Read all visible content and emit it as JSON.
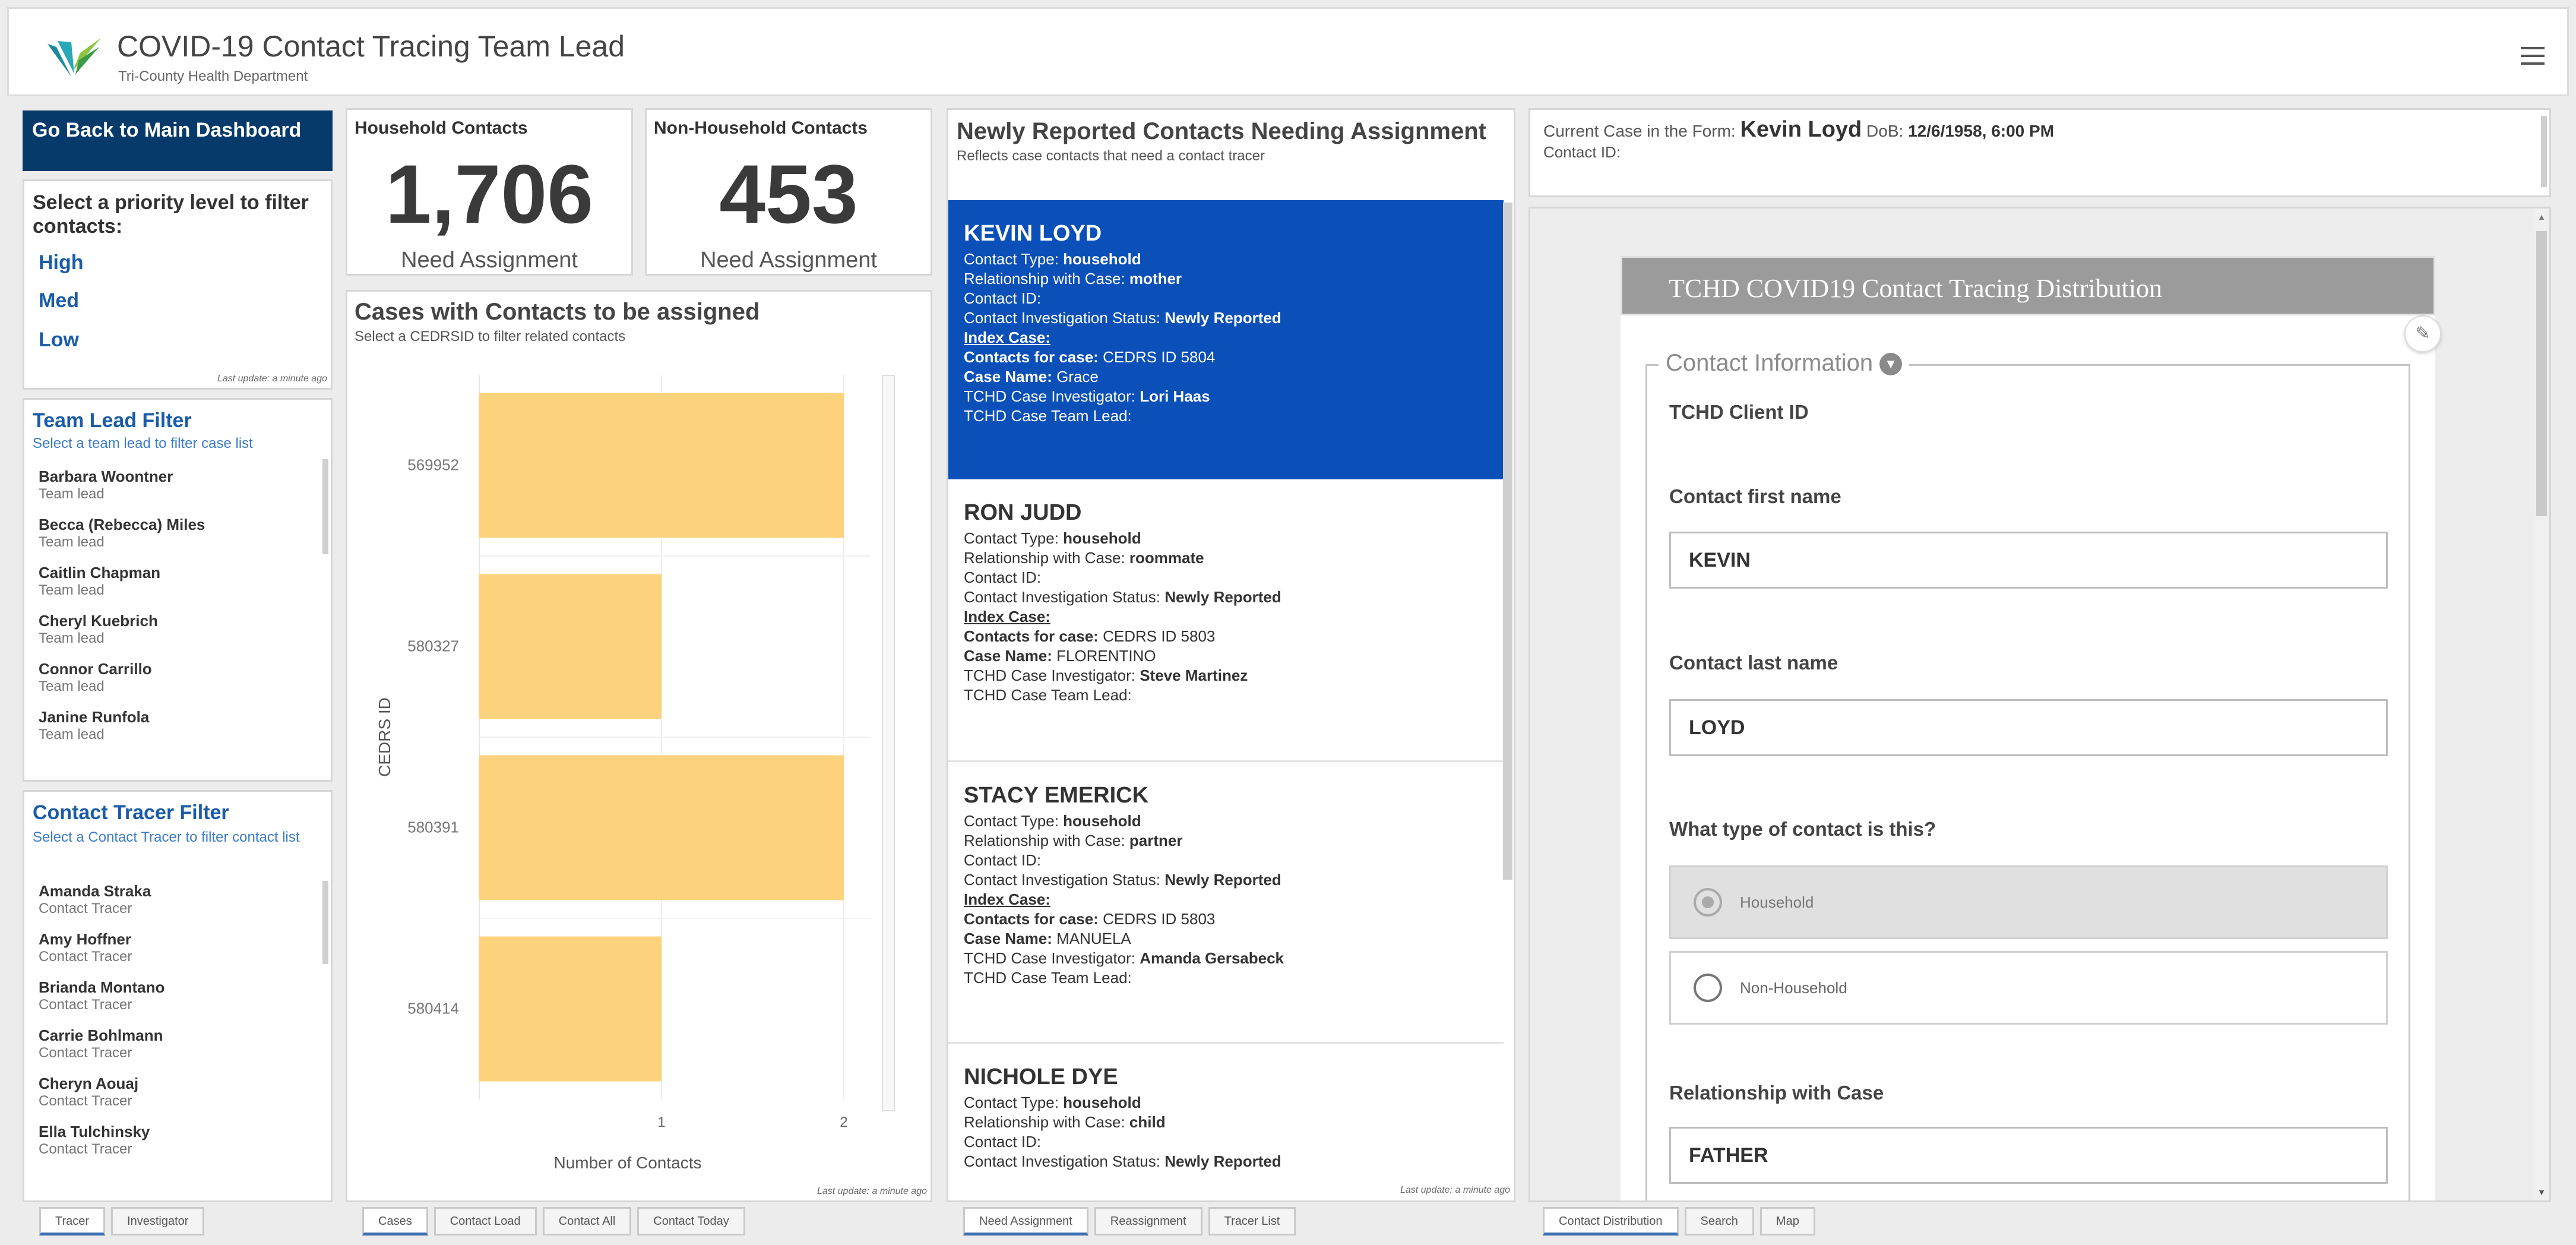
{
  "header": {
    "title": "COVID-19 Contact Tracing Team Lead",
    "subtitle": "Tri-County Health Department",
    "menu_icon": "hamburger-icon"
  },
  "left": {
    "back_button": "Go Back to Main Dashboard",
    "priority": {
      "title": "Select a priority level to filter contacts:",
      "items": [
        "High",
        "Med",
        "Low"
      ],
      "last_update": "Last update: a minute ago"
    },
    "team_lead": {
      "title": "Team Lead Filter",
      "subtitle": "Select a team lead to filter case list",
      "items": [
        {
          "name": "Barbara Woontner",
          "role": "Team lead"
        },
        {
          "name": "Becca (Rebecca) Miles",
          "role": "Team lead"
        },
        {
          "name": "Caitlin Chapman",
          "role": "Team lead"
        },
        {
          "name": "Cheryl Kuebrich",
          "role": "Team lead"
        },
        {
          "name": "Connor Carrillo",
          "role": "Team lead"
        },
        {
          "name": "Janine Runfola",
          "role": "Team lead"
        }
      ]
    },
    "tracer": {
      "title": "Contact Tracer Filter",
      "subtitle": "Select a Contact Tracer to filter contact list",
      "items": [
        {
          "name": "Amanda Straka",
          "role": "Contact Tracer"
        },
        {
          "name": "Amy Hoffner",
          "role": "Contact Tracer"
        },
        {
          "name": "Brianda Montano",
          "role": "Contact Tracer"
        },
        {
          "name": "Carrie Bohlmann",
          "role": "Contact Tracer"
        },
        {
          "name": "Cheryn Aouaj",
          "role": "Contact Tracer"
        },
        {
          "name": "Ella Tulchinsky",
          "role": "Contact Tracer"
        }
      ]
    },
    "tabs": [
      "Tracer",
      "Investigator"
    ]
  },
  "indicators": {
    "household": {
      "title": "Household Contacts",
      "value": "1,706",
      "label": "Need Assignment"
    },
    "non_household": {
      "title": "Non-Household Contacts",
      "value": "453",
      "label": "Need Assignment"
    }
  },
  "chart_panel": {
    "title": "Cases with Contacts to be assigned",
    "subtitle": "Select a CEDRSID to filter related contacts",
    "last_update": "Last update: a minute ago",
    "tabs": [
      "Cases",
      "Contact Load",
      "Contact All",
      "Contact Today"
    ]
  },
  "chart_data": {
    "type": "bar",
    "orientation": "horizontal",
    "categories": [
      "569952",
      "580327",
      "580391",
      "580414"
    ],
    "values": [
      2,
      1,
      2,
      1
    ],
    "xlabel": "Number of Contacts",
    "ylabel": "CEDRS ID",
    "xticks": [
      "1",
      "2"
    ],
    "xlim": [
      0,
      2.15
    ],
    "bar_color": "#fdd27c"
  },
  "contacts_panel": {
    "title": "Newly Reported Contacts Needing Assignment",
    "subtitle": "Reflects case contacts that need a contact tracer",
    "last_update": "Last update: a minute ago",
    "tabs": [
      "Need Assignment",
      "Reassignment",
      "Tracer List"
    ],
    "labels": {
      "type": "Contact Type: ",
      "rel": "Relationship with Case: ",
      "id": "Contact ID:",
      "status": "Contact Investigation Status: ",
      "index": "Index Case:",
      "for_case": "Contacts for case: ",
      "case_name": "Case Name: ",
      "investigator": "TCHD Case Investigator: ",
      "team_lead": "TCHD Case Team Lead:"
    },
    "contacts": [
      {
        "name": "KEVIN  LOYD",
        "type": "household",
        "rel": "mother",
        "status": "Newly Reported",
        "for_case": "CEDRS ID 5804",
        "case_name": "Grace",
        "investigator": "Lori Haas"
      },
      {
        "name": "RON JUDD",
        "type": "household",
        "rel": "roommate",
        "status": "Newly Reported",
        "for_case": "CEDRS ID 5803",
        "case_name": "FLORENTINO",
        "investigator": "Steve Martinez"
      },
      {
        "name": "STACY EMERICK",
        "type": "household",
        "rel": "partner",
        "status": "Newly Reported",
        "for_case": "CEDRS ID 5803",
        "case_name": "MANUELA",
        "investigator": "Amanda Gersabeck"
      },
      {
        "name": "NICHOLE DYE",
        "type": "household",
        "rel": "child",
        "status": "Newly Reported"
      }
    ]
  },
  "form_panel": {
    "current_label": "Current Case in the Form: ",
    "current_name": "Kevin Loyd",
    "dob_label": " DoB: ",
    "dob": "12/6/1958, 6:00 PM",
    "contact_id": "Contact ID:",
    "tabs": [
      "Contact Distribution",
      "Search",
      "Map"
    ],
    "form": {
      "banner": "TCHD COVID19 Contact Tracing Distribution",
      "section": "Contact Information",
      "client_id_label": "TCHD Client ID",
      "first_label": "Contact first name",
      "first_value": "KEVIN",
      "last_label": "Contact last name",
      "last_value": "LOYD",
      "type_label": "What type of contact is this?",
      "opt_household": "Household",
      "opt_non": "Non-Household",
      "rel_label": "Relationship with Case",
      "rel_value": "FATHER"
    }
  },
  "colors": {
    "brand_blue": "#0a50b8",
    "dark_blue": "#063a6b",
    "link_blue": "#1a5ca8",
    "bar": "#fdd27c"
  }
}
